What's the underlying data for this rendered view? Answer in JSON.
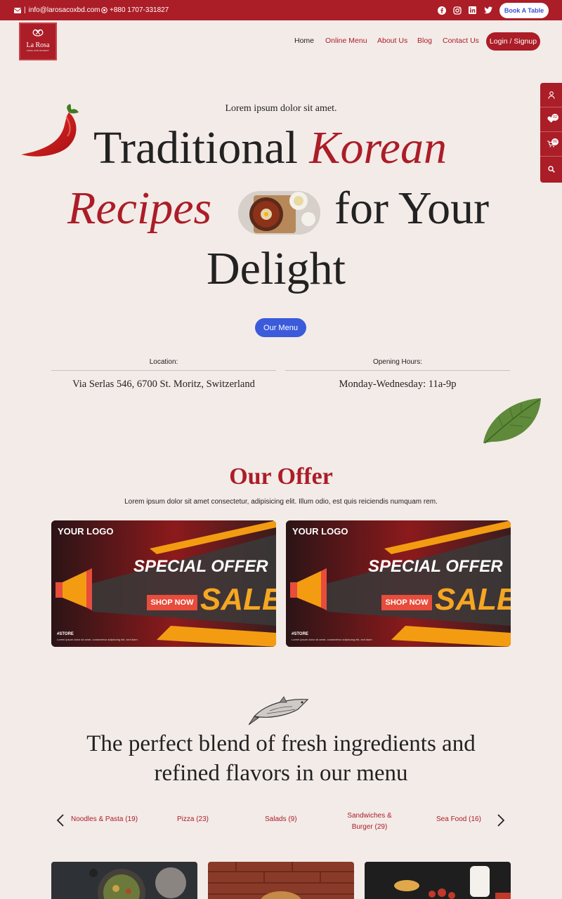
{
  "topbar": {
    "email": "info@larosacoxbd.com",
    "phone": "+880 1707-331827",
    "book_label": "Book A Table",
    "socials": [
      "facebook-icon",
      "instagram-icon",
      "linkedin-icon",
      "twitter-icon"
    ]
  },
  "brand": {
    "name": "La Rosa",
    "tagline": "CAFE AND BAKERY"
  },
  "nav": {
    "items": [
      "Home",
      "Online Menu",
      "About Us",
      "Blog",
      "Contact Us"
    ],
    "login_label": "Login / Signup"
  },
  "side": {
    "wishlist_count": "02",
    "cart_count": "06"
  },
  "hero": {
    "subtitle": "Lorem ipsum dolor sit amet.",
    "line1_plain": "Traditional",
    "line1_accent": "Korean",
    "line2_accent": "Recipes",
    "line2_plain": "for Your",
    "line3": "Delight",
    "button": "Our Menu"
  },
  "info": {
    "location_label": "Location:",
    "location_value": "Via Serlas 546, 6700 St. Moritz, Switzerland",
    "hours_label": "Opening Hours:",
    "hours_value": "Monday-Wednesday: 11a-9p"
  },
  "offer": {
    "title": "Our Offer",
    "description": "Lorem ipsum dolor sit amet consectetur, adipisicing elit. Illum odio, est quis reiciendis numquam rem.",
    "banner": {
      "logo": "YOUR LOGO",
      "headline": "SPECIAL OFFER",
      "shop": "SHOP NOW",
      "sale": "SALE",
      "store": "#STORE",
      "fine": "Lorem ipsum dolor sit amet, consectetur adipiscing elit, sed diam"
    }
  },
  "blend": {
    "line1": "The perfect blend of fresh ingredients and",
    "line2": "refined flavors in our menu"
  },
  "categories": [
    "Noodles & Pasta (19)",
    "Pizza (23)",
    "Salads (9)",
    "Sandwiches & Burger (29)",
    "Sea Food (16)"
  ],
  "colors": {
    "brand": "#ab1d27",
    "accent_button": "#3b5bdb",
    "background": "#f3ebe8"
  }
}
